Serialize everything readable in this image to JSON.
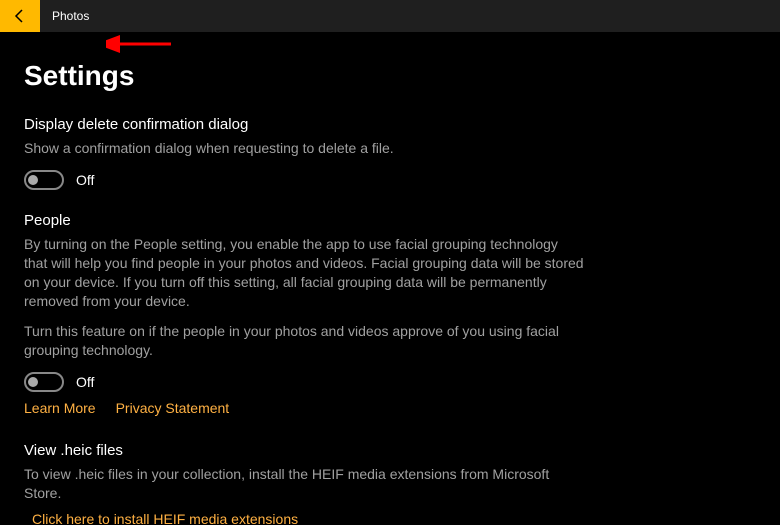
{
  "titlebar": {
    "app_name": "Photos"
  },
  "page_heading": "Settings",
  "sections": {
    "delete_confirm": {
      "title": "Display delete confirmation dialog",
      "desc": "Show a confirmation dialog when requesting to delete a file.",
      "toggle_state": "Off"
    },
    "people": {
      "title": "People",
      "desc1": "By turning on the People setting, you enable the app to use facial grouping technology that will help you find people in your photos and videos. Facial grouping data will be stored on your device. If you turn off this setting, all facial grouping data will be permanently removed from your device.",
      "desc2": "Turn this feature on if the people in your photos and videos approve of you using facial grouping technology.",
      "toggle_state": "Off",
      "learn_more": "Learn More",
      "privacy": "Privacy Statement"
    },
    "heic": {
      "title": "View .heic files",
      "desc": "To view .heic files in your collection, install the HEIF media extensions from Microsoft Store.",
      "install_link": "Click here to install HEIF media extensions"
    }
  },
  "annotation": {
    "arrow_color": "#ff0000"
  }
}
